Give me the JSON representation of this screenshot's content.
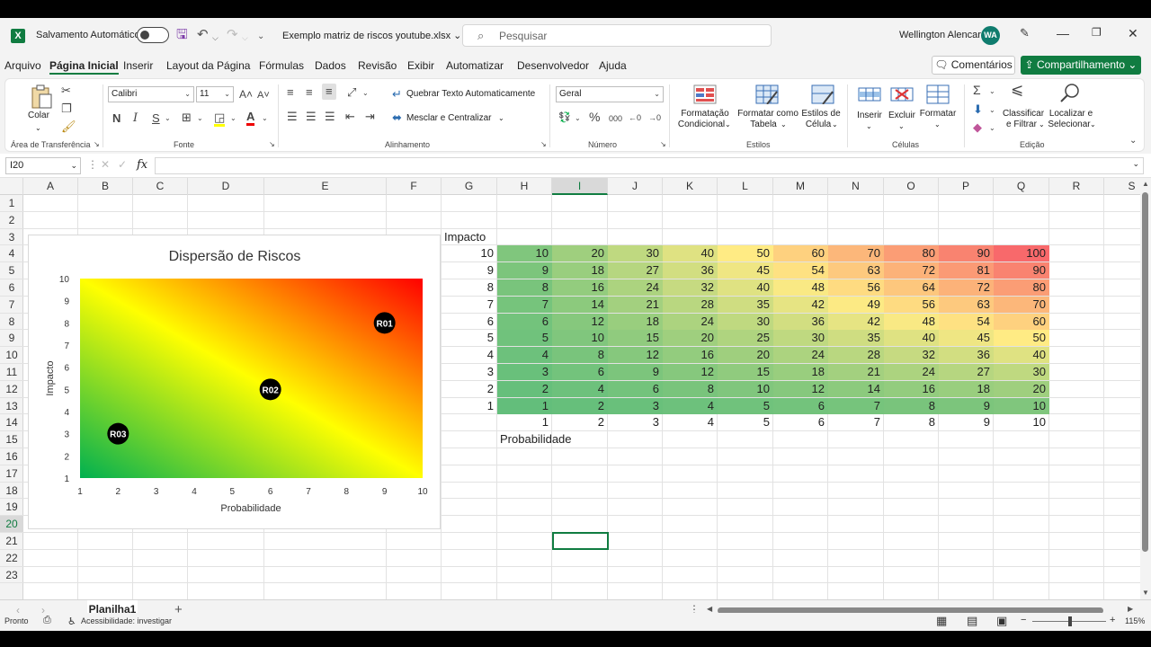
{
  "titlebar": {
    "autosave_label": "Salvamento Automático",
    "filename": "Exemplo matriz de riscos youtube.xlsx",
    "search_placeholder": "Pesquisar",
    "user_name": "Wellington Alencar",
    "user_initials": "WA"
  },
  "menu": {
    "items": [
      "Arquivo",
      "Página Inicial",
      "Inserir",
      "Layout da Página",
      "Fórmulas",
      "Dados",
      "Revisão",
      "Exibir",
      "Automatizar",
      "Desenvolvedor",
      "Ajuda"
    ],
    "active": "Página Inicial",
    "comments": "Comentários",
    "share": "Compartilhamento"
  },
  "ribbon": {
    "clipboard": {
      "paste": "Colar",
      "group": "Área de Transferência"
    },
    "font": {
      "name": "Calibri",
      "size": "11",
      "group": "Fonte",
      "bold": "N",
      "italic": "I",
      "underline": "S"
    },
    "alignment": {
      "wrap": "Quebrar Texto Automaticamente",
      "merge": "Mesclar e Centralizar",
      "group": "Alinhamento"
    },
    "number": {
      "format": "Geral",
      "group": "Número"
    },
    "styles": {
      "conditional1": "Formatação",
      "conditional2": "Condicional",
      "table1": "Formatar como",
      "table2": "Tabela",
      "cell1": "Estilos de",
      "cell2": "Célula",
      "group": "Estilos"
    },
    "cells": {
      "insert": "Inserir",
      "delete": "Excluir",
      "format": "Formatar",
      "group": "Células"
    },
    "editing": {
      "sort1": "Classificar",
      "sort2": "e Filtrar",
      "find1": "Localizar e",
      "find2": "Selecionar",
      "group": "Edição"
    }
  },
  "formula_bar": {
    "name_box": "I20",
    "fx": "fx",
    "value": ""
  },
  "columns": [
    "A",
    "B",
    "C",
    "D",
    "E",
    "F",
    "G",
    "H",
    "I",
    "J",
    "K",
    "L",
    "M",
    "N",
    "O",
    "P",
    "Q",
    "R",
    "S"
  ],
  "selected_column": "I",
  "selected_row": "20",
  "rows": [
    "1",
    "2",
    "3",
    "4",
    "5",
    "6",
    "7",
    "8",
    "9",
    "10",
    "11",
    "12",
    "13",
    "14",
    "15",
    "16",
    "17",
    "18",
    "19",
    "20",
    "21",
    "22",
    "23"
  ],
  "matrix": {
    "impact_label": "Impacto",
    "probability_label": "Probabilidade",
    "impact_values": [
      "10",
      "9",
      "8",
      "7",
      "6",
      "5",
      "4",
      "3",
      "2",
      "1"
    ],
    "probability_values": [
      "1",
      "2",
      "3",
      "4",
      "5",
      "6",
      "7",
      "8",
      "9",
      "10"
    ],
    "colors": {
      "low": "#63be7b",
      "mid": "#ffeb84",
      "high": "#f8696b"
    }
  },
  "chart_data": {
    "type": "scatter",
    "title": "Dispersão de Riscos",
    "xlabel": "Probabilidade",
    "ylabel": "Impacto",
    "xlim": [
      1,
      10
    ],
    "ylim": [
      1,
      10
    ],
    "xticks": [
      "1",
      "2",
      "3",
      "4",
      "5",
      "6",
      "7",
      "8",
      "9",
      "10"
    ],
    "yticks": [
      "1",
      "2",
      "3",
      "4",
      "5",
      "6",
      "7",
      "8",
      "9",
      "10"
    ],
    "points": [
      {
        "label": "R01",
        "x": 9,
        "y": 8
      },
      {
        "label": "R02",
        "x": 6,
        "y": 5
      },
      {
        "label": "R03",
        "x": 2,
        "y": 3
      }
    ],
    "gradient": {
      "from": "#00b050",
      "via": "#ffff00",
      "to": "#ff0000"
    }
  },
  "sheets": {
    "tabs": [
      "Planilha1"
    ],
    "active": "Planilha1"
  },
  "statusbar": {
    "mode": "Pronto",
    "accessibility": "Acessibilidade: investigar",
    "zoom": "115%"
  }
}
